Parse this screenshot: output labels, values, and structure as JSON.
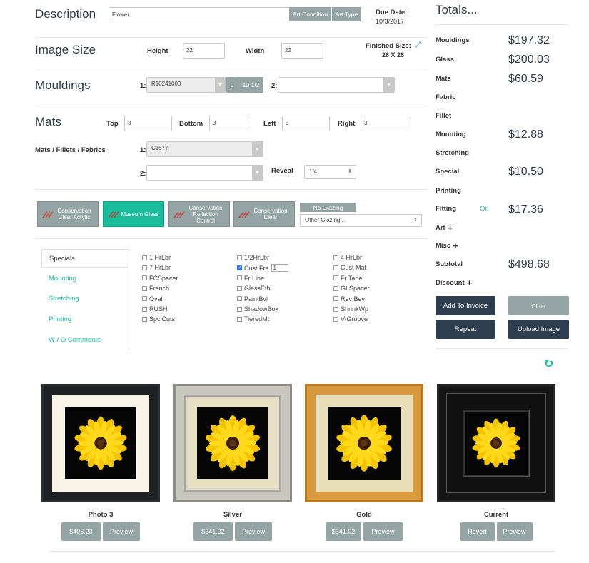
{
  "header": {
    "description_label": "Description",
    "description_value": "Flower",
    "art_condition_btn": "Art Condition",
    "art_type_btn": "Art Type",
    "due_label": "Due Date:",
    "due_value": "10/3/2017"
  },
  "image_size": {
    "label": "Image Size",
    "height_label": "Height",
    "height_value": "22",
    "width_label": "Width",
    "width_value": "22",
    "finished_label": "Finished Size:",
    "finished_value": "28 X 28"
  },
  "mouldings": {
    "label": "Mouldings",
    "slot1_label": "1:",
    "slot1_value": "R10241000",
    "l_btn": "L",
    "size_btn": "10 1/2",
    "slot2_label": "2:",
    "slot2_value": ""
  },
  "mats": {
    "label": "Mats",
    "top_label": "Top",
    "top_value": "3",
    "bottom_label": "Bottom",
    "bottom_value": "3",
    "left_label": "Left",
    "left_value": "3",
    "right_label": "Right",
    "right_value": "3",
    "mff_label": "Mats / Fillets / Fabrics",
    "slot1_label": "1:",
    "slot1_value": "C1577",
    "slot2_label": "2:",
    "slot2_value": "",
    "reveal_label": "Reveal",
    "reveal_value": "1/4"
  },
  "glazing": {
    "options": [
      "Conservation Clear Acrylic",
      "Museum Glass",
      "Conservation Reflection Control",
      "Conservation Clear"
    ],
    "no_glazing": "No Glazing",
    "other_glazing": "Other Glazing..."
  },
  "tabs": [
    "Specials",
    "Mounting",
    "Stretching",
    "Printing",
    "W / O Comments"
  ],
  "specials": {
    "col1": [
      "1 HrLbr",
      "7 HrLbr",
      "FCSpacer",
      "French",
      "Oval",
      "RUSH",
      "SpclCuts"
    ],
    "col2": [
      "1/2HrLbr",
      "Cust Fra",
      "Fr Line",
      "GlassEth",
      "PaintBvl",
      "ShadowBox",
      "TieredMt"
    ],
    "col3": [
      "4 HrLbr",
      "Cust Mat",
      "Fr Tape",
      "GLSpacer",
      "Rev Bev",
      "ShrinkWp",
      "V-Groove"
    ],
    "cust_fra_qty": "1"
  },
  "totals": {
    "title": "Totals...",
    "mouldings_label": "Mouldings",
    "mouldings_value": "$197.32",
    "glass_label": "Glass",
    "glass_value": "$200.03",
    "mats_label": "Mats",
    "mats_value": "$60.59",
    "fabric_label": "Fabric",
    "fillet_label": "Fillet",
    "mounting_label": "Mounting",
    "mounting_value": "$12.88",
    "stretching_label": "Stretching",
    "special_label": "Special",
    "special_value": "$10.50",
    "printing_label": "Printing",
    "fitting_label": "Fitting",
    "fitting_status": "On",
    "fitting_value": "$17.36",
    "art_label": "Art",
    "misc_label": "Misc",
    "subtotal_label": "Subtotal",
    "subtotal_value": "$498.68",
    "discount_label": "Discount"
  },
  "actions": {
    "add_to_invoice": "Add To Invoice",
    "clear": "Clear",
    "repeat": "Repeat",
    "upload_image": "Upload Image"
  },
  "previews": [
    {
      "caption": "Photo 3",
      "btn1": "$406.23",
      "btn2": "Preview"
    },
    {
      "caption": "Silver",
      "btn1": "$341.02",
      "btn2": "Preview"
    },
    {
      "caption": "Gold",
      "btn1": "$341.02",
      "btn2": "Preview"
    },
    {
      "caption": "Current",
      "btn1": "Revert",
      "btn2": "Preview"
    }
  ],
  "colors": {
    "accent": "#1abc9c",
    "dark": "#2c3e50",
    "gray_btn": "#95a5a6"
  }
}
